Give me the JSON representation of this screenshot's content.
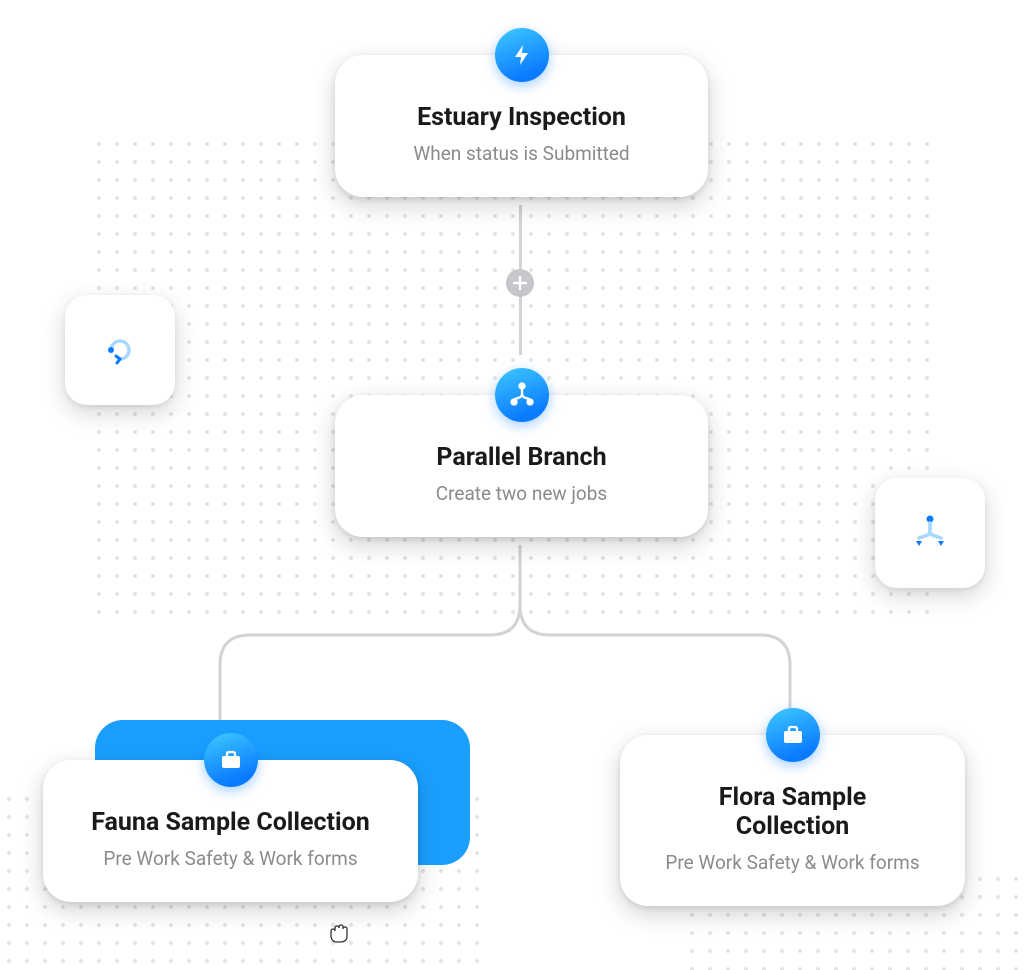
{
  "nodes": {
    "trigger": {
      "title": "Estuary Inspection",
      "subtitle": "When status is Submitted"
    },
    "branch": {
      "title": "Parallel Branch",
      "subtitle": "Create two new jobs"
    },
    "job_left": {
      "title": "Fauna Sample Collection",
      "subtitle": "Pre Work Safety & Work forms"
    },
    "job_right": {
      "title": "Flora Sample Collection",
      "subtitle": "Pre Work Safety & Work forms"
    }
  },
  "icons": {
    "lightning": "lightning-icon",
    "branch": "branch-icon",
    "briefcase": "briefcase-icon",
    "reload": "reload-icon",
    "split": "split-icon",
    "plus": "plus-icon"
  }
}
